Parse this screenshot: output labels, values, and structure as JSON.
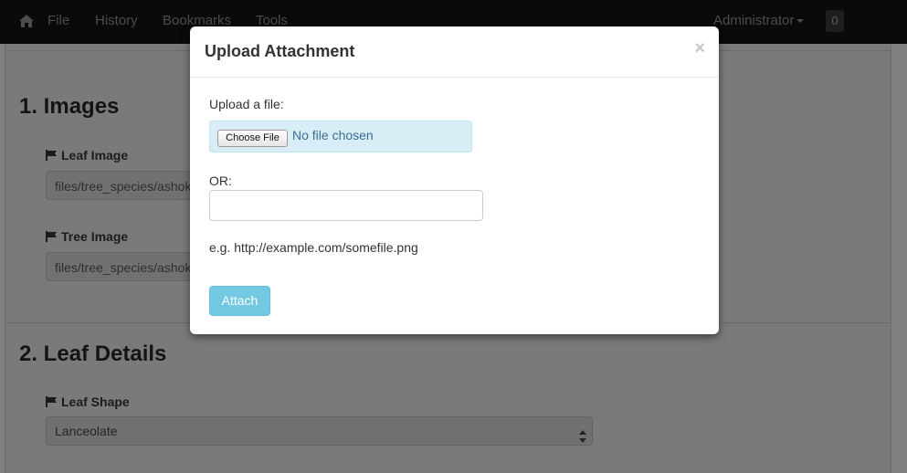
{
  "navbar": {
    "items": [
      {
        "label": "File"
      },
      {
        "label": "History"
      },
      {
        "label": "Bookmarks"
      },
      {
        "label": "Tools"
      }
    ],
    "user_label": "Administrator",
    "notification_count": "0"
  },
  "page": {
    "sections": [
      {
        "title": "1. Images"
      },
      {
        "title": "2. Leaf Details"
      }
    ],
    "fields": [
      {
        "label": "Leaf Image",
        "value": "files/tree_species/ashok"
      },
      {
        "label": "Tree Image",
        "value": "files/tree_species/ashok"
      },
      {
        "label": "Leaf Shape",
        "value": "Lanceolate"
      }
    ]
  },
  "modal": {
    "title": "Upload Attachment",
    "close_symbol": "×",
    "upload_label": "Upload a file:",
    "choose_button_label": "Choose File",
    "no_file_text": "No file chosen",
    "or_label": "OR:",
    "url_value": "",
    "example_text": "e.g. http://example.com/somefile.png",
    "attach_label": "Attach"
  },
  "colors": {
    "navbar_bg": "#0a0a0a",
    "attach_button": "#5bc0de",
    "file_box_bg": "#d9edf7"
  },
  "icons": {
    "home": "home-icon",
    "flag": "flag-icon",
    "close": "close-icon",
    "select_arrows": "select-arrows-icon"
  }
}
